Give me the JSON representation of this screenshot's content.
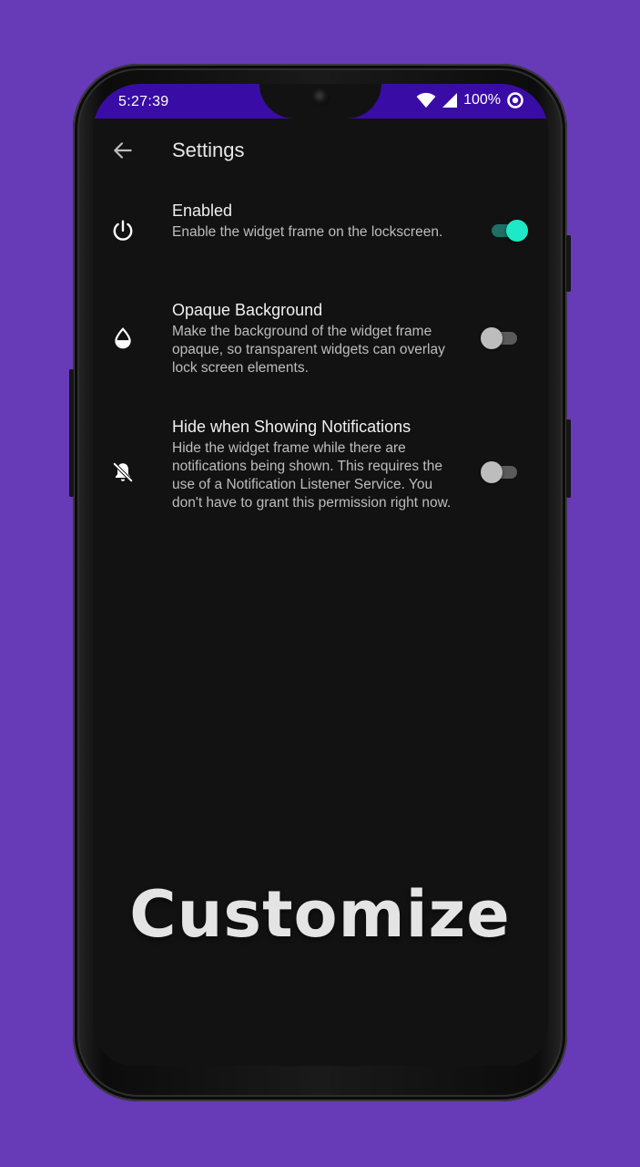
{
  "status_bar": {
    "time": "5:27:39",
    "battery": "100%",
    "background_color": "#3a0ca6"
  },
  "app_bar": {
    "back_icon": "arrow-left-icon",
    "title": "Settings"
  },
  "settings": [
    {
      "icon": "power-icon",
      "title": "Enabled",
      "description": "Enable the widget frame on the lockscreen.",
      "enabled": true
    },
    {
      "icon": "water-drop-icon",
      "title": "Opaque Background",
      "description": "Make the background of the widget frame opaque, so transparent widgets can overlay lock screen elements.",
      "enabled": false
    },
    {
      "icon": "notifications-off-icon",
      "title": "Hide when Showing Notifications",
      "description": "Hide the widget frame while there are notifications being shown. This requires the use of a Notification Listener Service. You don't have to grant this permission right now.",
      "enabled": false
    }
  ],
  "promo_caption": "Customize",
  "colors": {
    "page_background": "#673AB7",
    "accent": "#1de9c6",
    "screen_background": "#121212"
  }
}
